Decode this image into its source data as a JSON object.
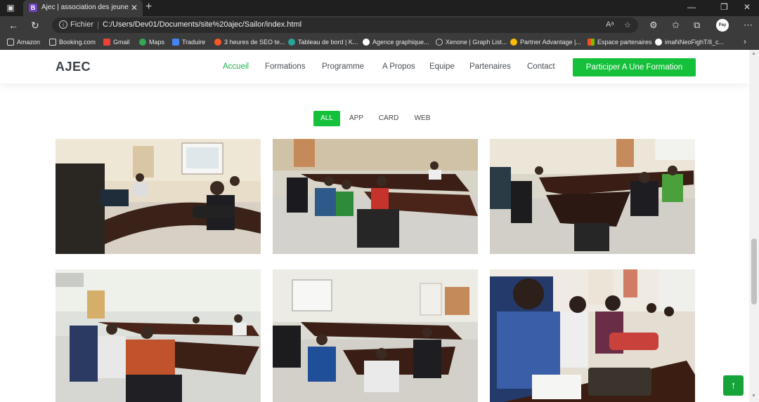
{
  "browser": {
    "tab_title": "Ajec | association des jeunes ent",
    "tab_favicon_letter": "B",
    "url_scheme": "Fichier",
    "url": "C:/Users/Dev01/Documents/site%20ajec/Sailor/index.html",
    "profile_label": "Pay",
    "bookmarks": [
      {
        "label": "Amazon",
        "icon_color": "#ffffff"
      },
      {
        "label": "Booking.com",
        "icon_color": "#ffffff"
      },
      {
        "label": "Gmail",
        "icon_color": "#ea4335"
      },
      {
        "label": "Maps",
        "icon_color": "#34a853"
      },
      {
        "label": "Traduire",
        "icon_color": "#4285f4"
      },
      {
        "label": "3 heures de SEO te...",
        "icon_color": "#ff5722"
      },
      {
        "label": "Tableau de bord | K...",
        "icon_color": "#26a69a"
      },
      {
        "label": "Agence graphique...",
        "icon_color": "#ffffff"
      },
      {
        "label": "Xenone | Graph List...",
        "icon_color": "#cccccc"
      },
      {
        "label": "Partner Advantage |...",
        "icon_color": "#fbbc05"
      },
      {
        "label": "Espace partenaires",
        "icon_color": "#f25022"
      },
      {
        "label": "imaNNeoFighT/ll_c...",
        "icon_color": "#ffffff"
      }
    ]
  },
  "site": {
    "logo": "AJEC",
    "menu": [
      {
        "label": "Accueil",
        "active": true
      },
      {
        "label": "Formations",
        "active": false
      },
      {
        "label": "Programme",
        "active": false
      },
      {
        "label": "A Propos",
        "active": false
      },
      {
        "label": "Equipe",
        "active": false
      },
      {
        "label": "Partenaires",
        "active": false
      },
      {
        "label": "Contact",
        "active": false
      }
    ],
    "cta_label": "Participer A Une Formation"
  },
  "portfolio": {
    "filters": [
      {
        "label": "ALL",
        "active": true
      },
      {
        "label": "APP",
        "active": false
      },
      {
        "label": "CARD",
        "active": false
      },
      {
        "label": "WEB",
        "active": false
      }
    ],
    "photos": [
      {
        "name": "training-photo-1",
        "subject": "meeting-room-projector"
      },
      {
        "name": "training-photo-2",
        "subject": "u-shaped-tables-participants"
      },
      {
        "name": "training-photo-3",
        "subject": "participants-laptops"
      },
      {
        "name": "training-photo-4",
        "subject": "room-wide-view"
      },
      {
        "name": "training-photo-5",
        "subject": "whiteboard-session"
      },
      {
        "name": "training-photo-6",
        "subject": "participants-closeup"
      }
    ]
  },
  "colors": {
    "accent": "#15c03a",
    "active_link": "#22b14c",
    "text": "#4a4f55"
  }
}
